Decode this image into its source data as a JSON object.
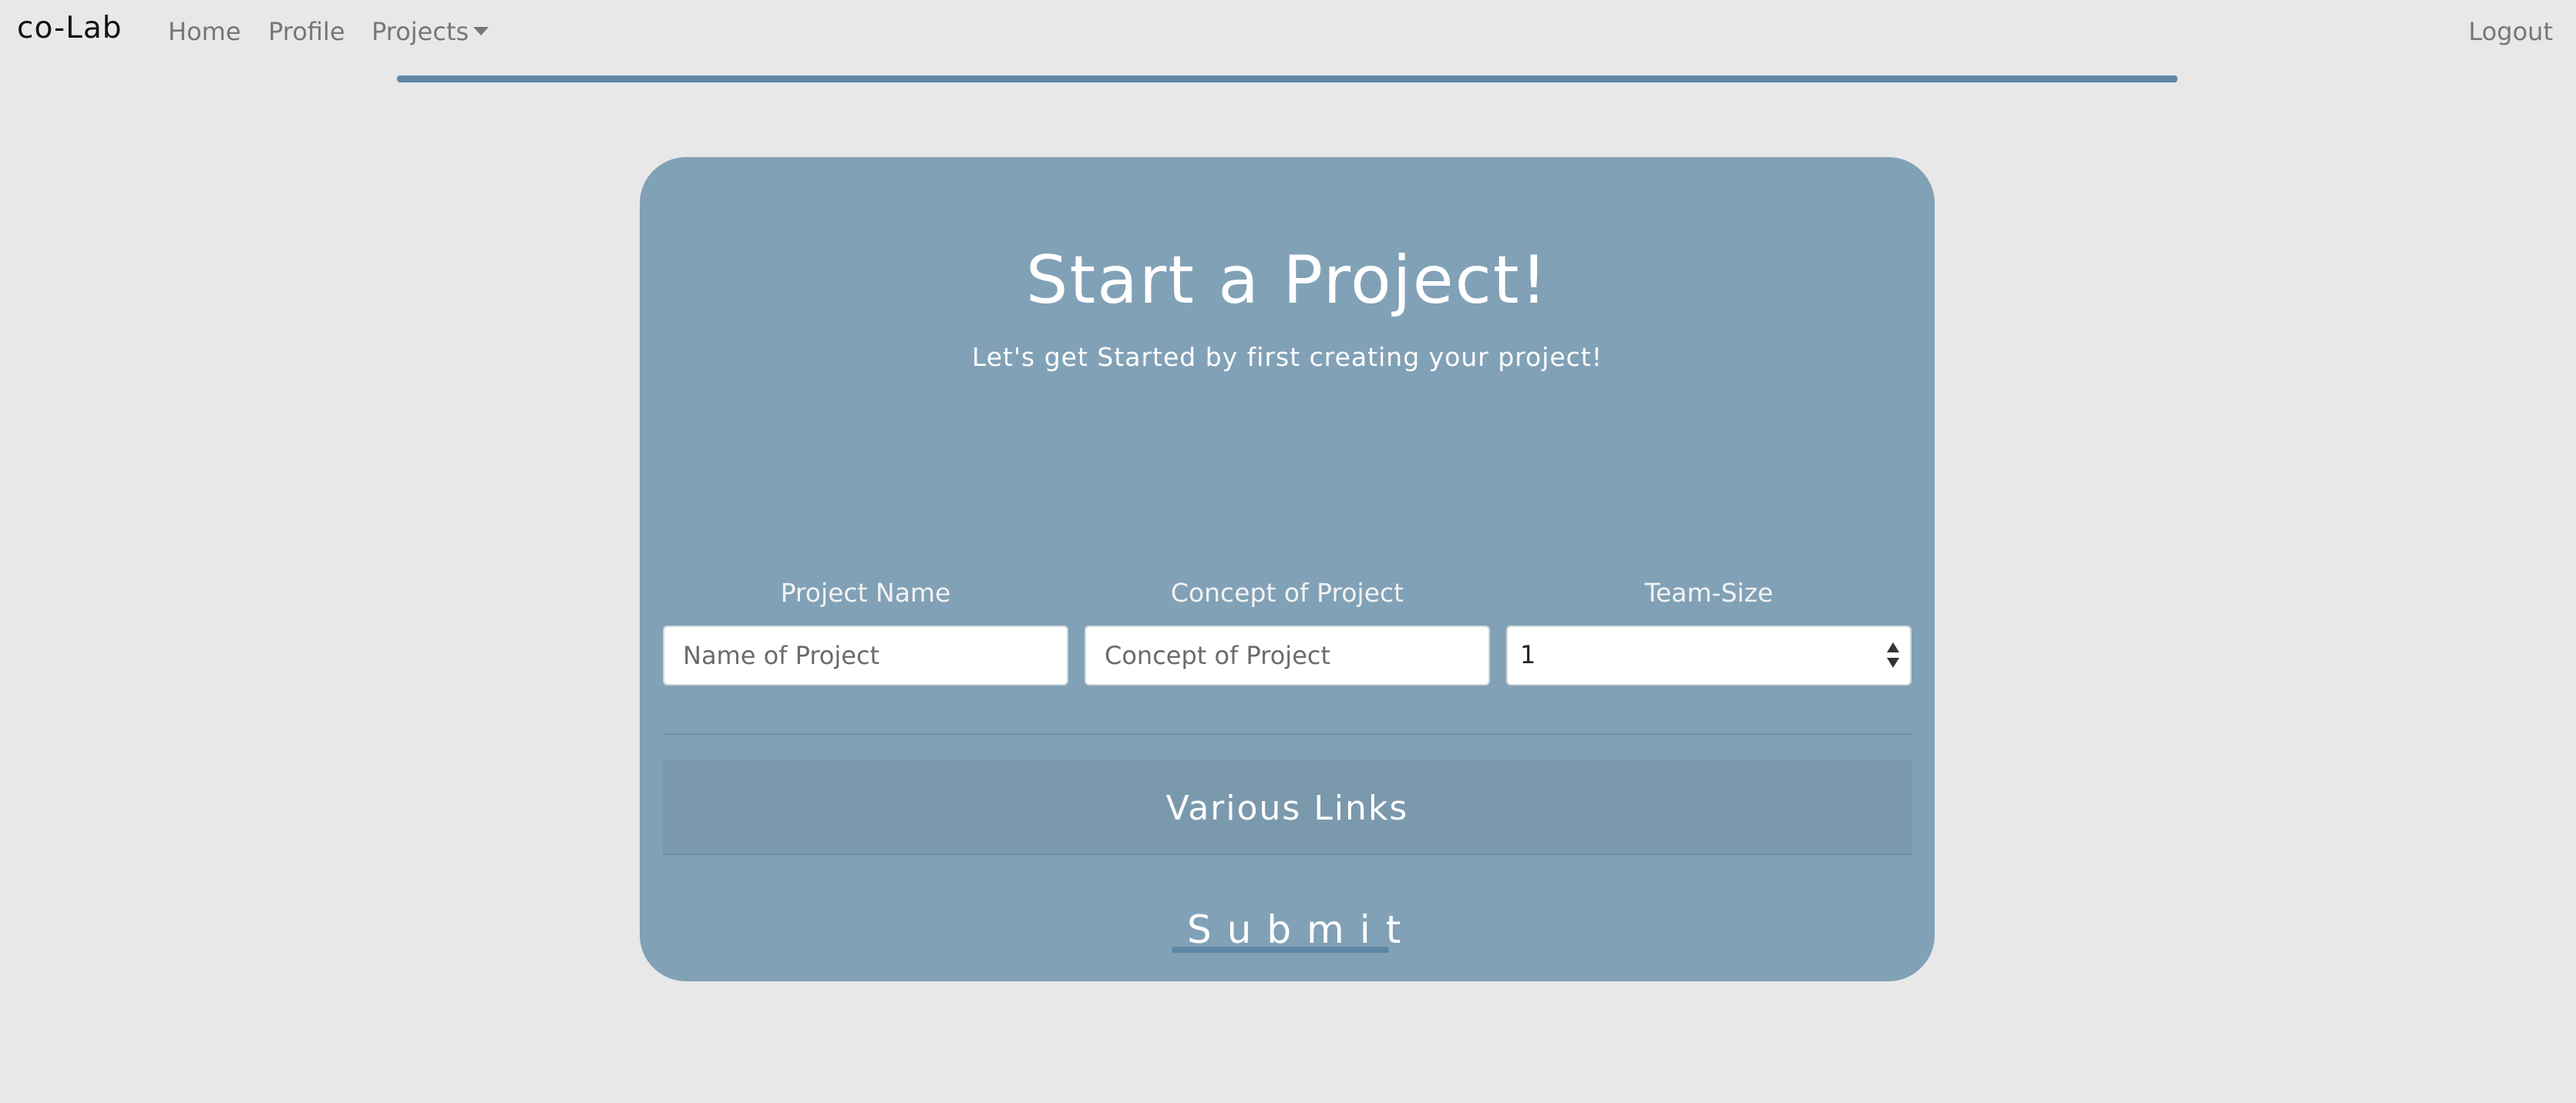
{
  "nav": {
    "brand": "co-Lab",
    "home": "Home",
    "profile": "Profile",
    "projects": "Projects",
    "logout": "Logout"
  },
  "colors": {
    "page_bg": "#e8e8e8",
    "card_bg": "#81a1b6",
    "accent": "#5e87a6",
    "links_panel_bg": "#7b99ad"
  },
  "card": {
    "title": "Start a Project!",
    "subtitle": "Let's get Started by first creating your project!"
  },
  "form": {
    "project_name": {
      "label": "Project Name",
      "placeholder": "Name of Project",
      "value": ""
    },
    "concept": {
      "label": "Concept of Project",
      "placeholder": "Concept of Project",
      "value": ""
    },
    "team_size": {
      "label": "Team-Size",
      "selected": "1"
    },
    "links_title": "Various Links",
    "submit_label": "Submit"
  },
  "icons": {
    "projects_dropdown": "caret-down-icon",
    "select_arrows": "select-arrows-icon"
  }
}
